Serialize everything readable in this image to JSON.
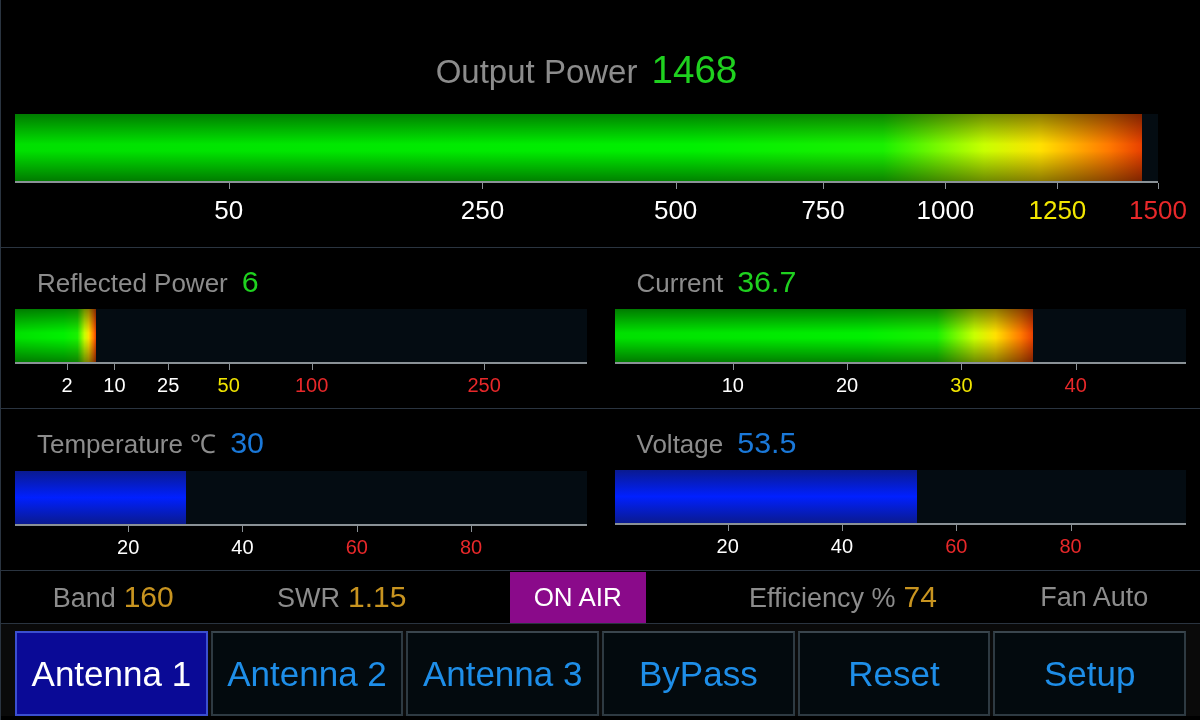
{
  "meters": [
    {
      "label": "Output Power",
      "value": "1468",
      "level": 0.986,
      "kind": "heat",
      "ticks": [
        {
          "label": "50",
          "color": "#ffffff"
        },
        {
          "label": "250",
          "color": "#ffffff"
        },
        {
          "label": "500",
          "color": "#ffffff"
        },
        {
          "label": "750",
          "color": "#ffffff"
        },
        {
          "label": "1000",
          "color": "#ffffff"
        },
        {
          "label": "1250",
          "color": "#f2e600"
        },
        {
          "label": "1500",
          "color": "#e8282a"
        }
      ]
    },
    {
      "label": "Reflected Power",
      "value": "6",
      "level": 0.142,
      "kind": "heat",
      "ticks": [
        {
          "label": "2",
          "color": "#ffffff"
        },
        {
          "label": "10",
          "color": "#ffffff"
        },
        {
          "label": "25",
          "color": "#ffffff"
        },
        {
          "label": "50",
          "color": "#f2e600"
        },
        {
          "label": "100",
          "color": "#e8282a"
        },
        {
          "label": "250",
          "color": "#e8282a"
        }
      ]
    },
    {
      "label": "Current",
      "value": "36.7",
      "level": 0.733,
      "kind": "heat",
      "ticks": [
        {
          "label": "10",
          "color": "#ffffff"
        },
        {
          "label": "20",
          "color": "#ffffff"
        },
        {
          "label": "30",
          "color": "#f2e600"
        },
        {
          "label": "40",
          "color": "#e8282a"
        }
      ]
    },
    {
      "label": "Temperature ℃",
      "value": "30",
      "level": 0.3,
      "kind": "cool",
      "ticks": [
        {
          "label": "20",
          "color": "#ffffff"
        },
        {
          "label": "40",
          "color": "#ffffff"
        },
        {
          "label": "60",
          "color": "#e8282a"
        },
        {
          "label": "80",
          "color": "#e8282a"
        }
      ]
    },
    {
      "label": "Voltage",
      "value": "53.5",
      "level": 0.53,
      "kind": "cool",
      "ticks": [
        {
          "label": "20",
          "color": "#ffffff"
        },
        {
          "label": "40",
          "color": "#ffffff"
        },
        {
          "label": "60",
          "color": "#e8282a"
        },
        {
          "label": "80",
          "color": "#e8282a"
        }
      ]
    }
  ],
  "status_bar": [
    {
      "kind": "reading",
      "label": "Band",
      "value": "160"
    },
    {
      "kind": "reading",
      "label": "SWR",
      "value": "1.15"
    },
    {
      "kind": "badge",
      "label": "ON AIR"
    },
    {
      "kind": "reading",
      "label": "Efficiency %",
      "value": "74"
    },
    {
      "kind": "text",
      "label": "Fan Auto"
    }
  ],
  "buttons": [
    {
      "label": "Antenna 1",
      "selected": true
    },
    {
      "label": "Antenna 2",
      "selected": false
    },
    {
      "label": "Antenna 3",
      "selected": false
    },
    {
      "label": "ByPass",
      "selected": false
    },
    {
      "label": "Reset",
      "selected": false
    },
    {
      "label": "Setup",
      "selected": false
    }
  ]
}
